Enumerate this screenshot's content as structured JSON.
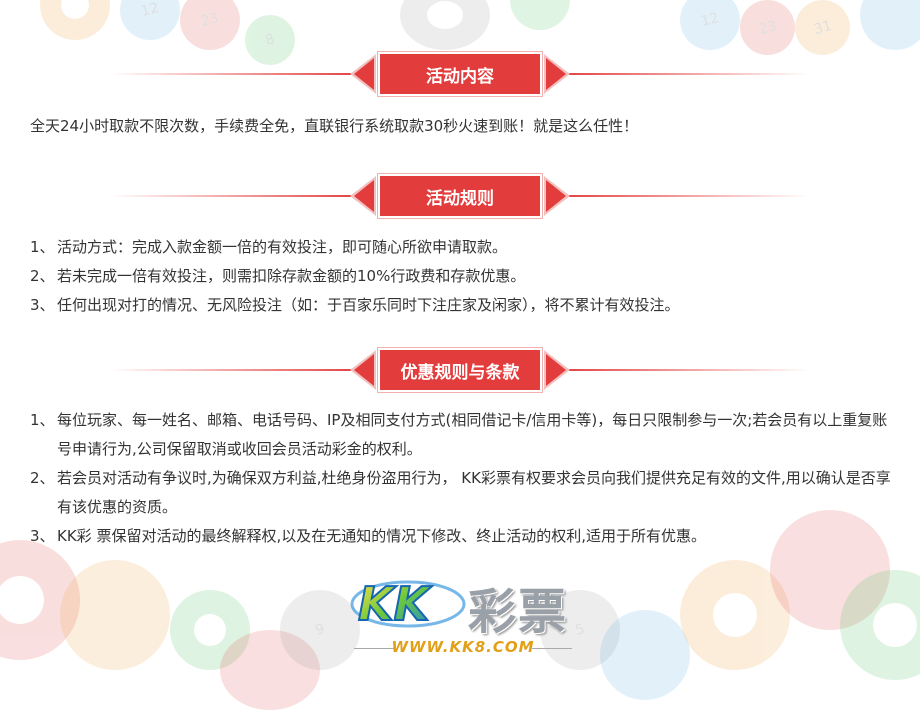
{
  "sections": {
    "content": {
      "title": "活动内容",
      "text": "全天24小时取款不限次数，手续费全免，直联银行系统取款30秒火速到账！就是这么任性！"
    },
    "rules": {
      "title": "活动规则",
      "items": [
        {
          "num": "1、",
          "text": "活动方式：完成入款金额一倍的有效投注，即可随心所欲申请取款。"
        },
        {
          "num": "2、",
          "text": "若未完成一倍有效投注，则需扣除存款金额的10%行政费和存款优惠。"
        },
        {
          "num": "3、",
          "text": "任何出现对打的情况、无风险投注（如：于百家乐同时下注庄家及闲家），将不累计有效投注。"
        }
      ]
    },
    "terms": {
      "title": "优惠规则与条款",
      "items": [
        {
          "num": "1、",
          "text": "每位玩家、每一姓名、邮箱、电话号码、IP及相同支付方式(相同借记卡/信用卡等)，每日只限制参与一次;若会员有以上重复账号申请行为,公司保留取消或收回会员活动彩金的权利。"
        },
        {
          "num": "2、",
          "text": "若会员对活动有争议时,为确保双方利益,杜绝身份盗用行为，  KK彩票有权要求会员向我们提供充足有效的文件,用以确认是否享有该优惠的资质。"
        },
        {
          "num": "3、",
          "text": "KK彩 票保留对活动的最终解释权,以及在无通知的情况下修改、终止活动的权利,适用于所有优惠。"
        }
      ]
    }
  },
  "logo": {
    "brand_latin": "KK",
    "brand_cn": "彩票",
    "url": "WWW.KK8.COM"
  },
  "decor": {
    "ball_numbers": [
      "8",
      "12",
      "23",
      "8",
      "12",
      "23",
      "31",
      "9",
      "5"
    ]
  },
  "colors": {
    "accent": "#e23c3c",
    "text": "#333333",
    "logo_url": "#e2a018"
  }
}
